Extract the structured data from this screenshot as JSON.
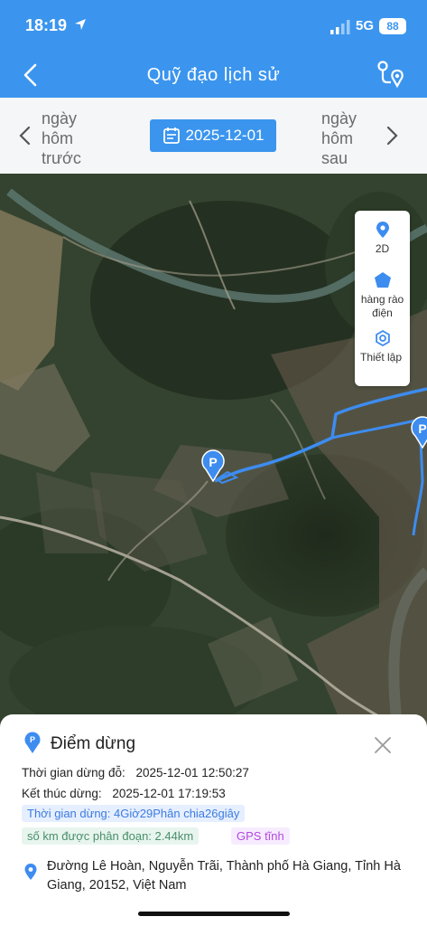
{
  "status_bar": {
    "time": "18:19",
    "network": "5G",
    "battery": "88"
  },
  "header": {
    "title": "Quỹ đạo lịch sử",
    "back_icon": "chevron-left-icon",
    "route_icon": "route-icon"
  },
  "date_nav": {
    "prev_label": "ngày hôm trước",
    "next_label": "ngày hôm sau",
    "date": "2025-12-01"
  },
  "map_tools": {
    "view_mode": "2D",
    "geofence": "hàng rào điện",
    "settings": "Thiết lập"
  },
  "map": {
    "marker_label": "P",
    "track_color": "#3d8cf0"
  },
  "stop_panel": {
    "title": "Điểm dừng",
    "park_time_label": "Thời gian dừng đỗ:",
    "park_time_value": "2025-12-01 12:50:27",
    "end_label": "Kết thúc dừng:",
    "end_value": "2025-12-01 17:19:53",
    "duration_chip": "Thời gian dừng: 4Giờ29Phân chia26giây",
    "distance_chip": "số km được phân đoạn: 2.44km",
    "gps_chip": "GPS tĩnh",
    "address": "Đường Lê Hoàn, Nguyễn Trãi, Thành phố Hà Giang, Tỉnh Hà Giang, 20152, Việt Nam"
  },
  "colors": {
    "primary": "#3b95ee",
    "track": "#3d8cf0"
  }
}
